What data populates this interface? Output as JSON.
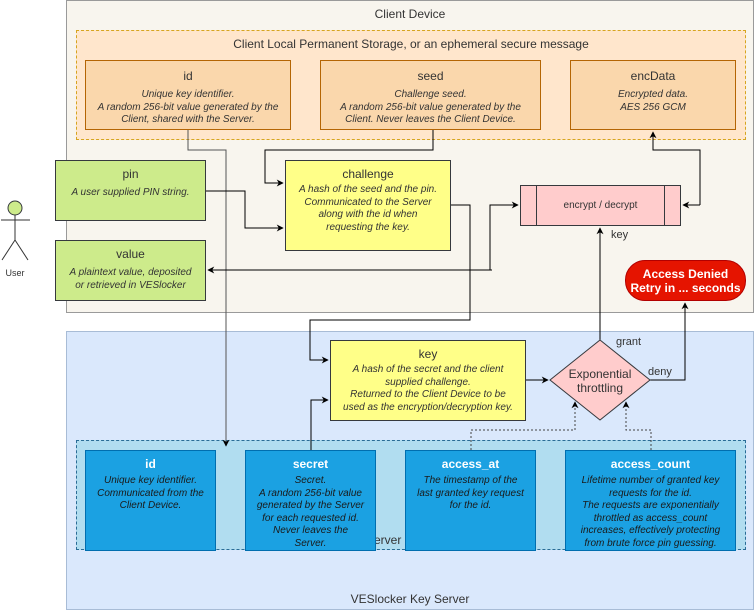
{
  "client_device": {
    "title": "Client Device",
    "storage": {
      "title": "Client Local Permanent Storage, or an ephemeral secure message",
      "items": [
        {
          "name": "id",
          "desc": [
            "Unique key identifier.",
            "A random 256-bit value generated by the",
            "Client, shared with the Server."
          ]
        },
        {
          "name": "seed",
          "desc": [
            "Challenge seed.",
            "A random 256-bit value generated by the",
            "Client. Never leaves the Client Device."
          ]
        },
        {
          "name": "encData",
          "desc": [
            "Encrypted data.",
            "AES 256 GCM"
          ]
        }
      ]
    },
    "pin": {
      "name": "pin",
      "desc": [
        "A user supplied  PIN string."
      ]
    },
    "value": {
      "name": "value",
      "desc": [
        "A plaintext value, deposited",
        "or retrieved in VESlocker"
      ]
    },
    "challenge": {
      "name": "challenge",
      "desc": [
        "A hash of the seed and the pin.",
        "Communicated to the Server",
        "along with the id when",
        "requesting the key."
      ]
    },
    "process": {
      "label": "encrypt / decrypt"
    },
    "key_label": "key",
    "denied": {
      "line1": "Access Denied",
      "line2": "Retry in ... seconds"
    }
  },
  "actor": {
    "label": "User"
  },
  "server": {
    "title": "VESlocker Key Server",
    "key": {
      "name": "key",
      "desc": [
        "A hash of the secret and the client",
        "supplied challenge.",
        "Returned to the Client Device to be",
        "used as the encryption/decryption key."
      ]
    },
    "decision": {
      "line1": "Exponential",
      "line2": "throttling",
      "grant_label": "grant",
      "deny_label": "deny"
    },
    "database": {
      "title": "Server Database",
      "items": [
        {
          "name": "id",
          "desc": [
            "Unique key identifier.",
            "Communicated from the",
            "Client Device."
          ]
        },
        {
          "name": "secret",
          "desc": [
            "Secret.",
            "A random 256-bit value",
            "generated by the Server",
            "for each requested id.",
            "Never leaves the",
            "Server."
          ]
        },
        {
          "name": "access_at",
          "desc": [
            "The timestamp of the",
            "last granted key request",
            "for the id."
          ]
        },
        {
          "name": "access_count",
          "desc": [
            "Lifetime number of granted key",
            "requests for the id.",
            "The requests are exponentially",
            "throttled as access_count",
            "increases, effectively protecting",
            "from brute force pin guessing."
          ]
        }
      ]
    }
  },
  "colors": {
    "client_bg": "#f8f5ee",
    "storage_bg": "#ffe6cc",
    "orange_box": "#fad7ac",
    "green_box": "#cdeb8b",
    "yellow_box": "#ffff88",
    "process_box": "#ffcccc",
    "denied": "#e51400",
    "server_bg": "#dae8fc",
    "db_bg": "#b1ddf0",
    "db_box": "#1ba1e2"
  }
}
